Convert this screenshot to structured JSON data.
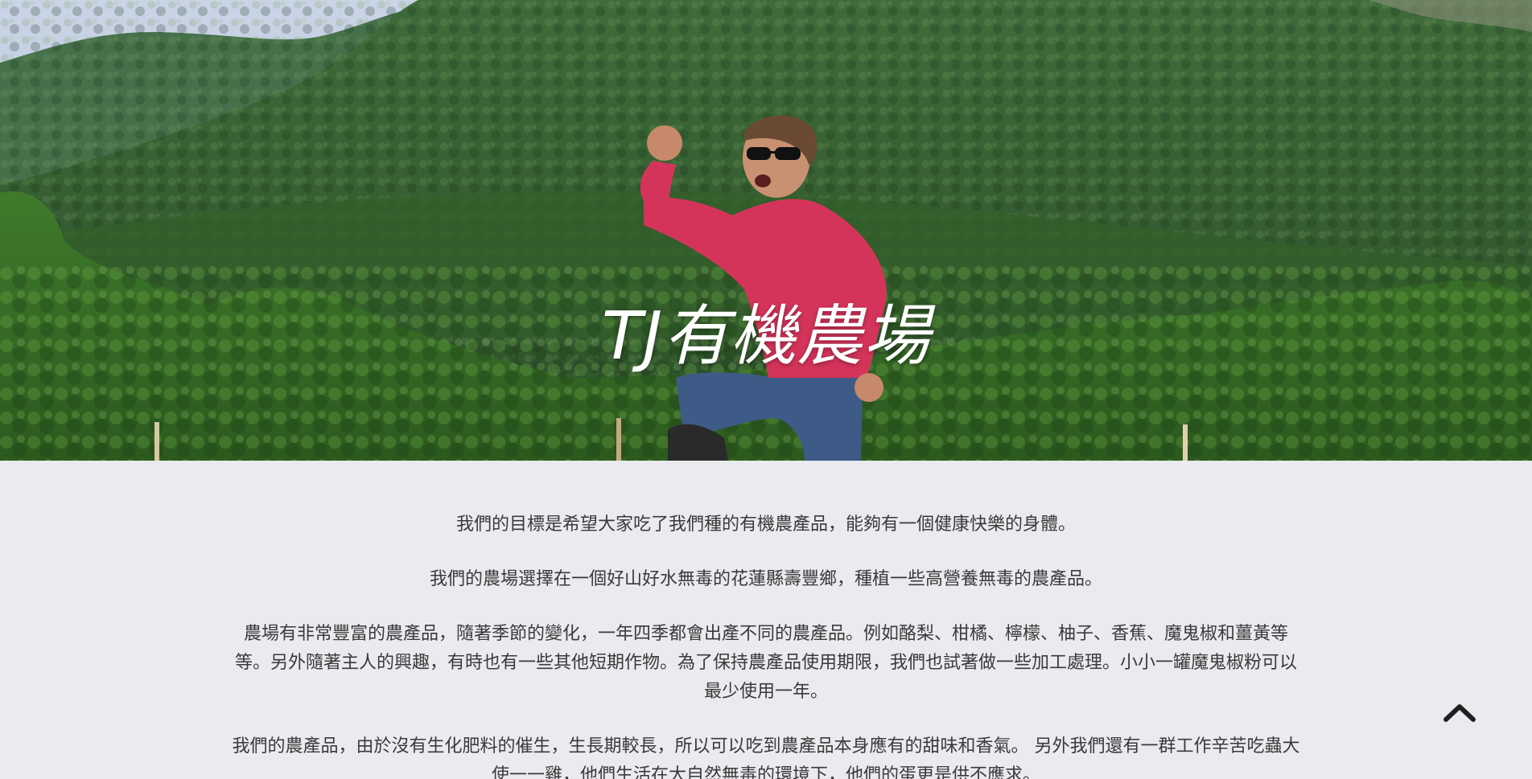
{
  "hero": {
    "title": "TJ有機農場",
    "image_alt": "farmer-jumping-in-green-mountains-photo"
  },
  "about": {
    "paragraphs": [
      "我們的目標是希望大家吃了我們種的有機農產品，能夠有一個健康快樂的身體。",
      "我們的農場選擇在一個好山好水無毒的花蓮縣壽豐鄉，種植一些高營養無毒的農產品。",
      "農場有非常豐富的農產品，隨著季節的變化，一年四季都會出產不同的農產品。例如酪梨、柑橘、檸檬、柚子、香蕉、魔鬼椒和薑黃等等。另外隨著主人的興趣，有時也有一些其他短期作物。為了保持農產品使用期限，我們也試著做一些加工處理。小小一罐魔鬼椒粉可以最少使用一年。",
      "我們的農產品，由於沒有生化肥料的催生，生長期較長，所以可以吃到農產品本身應有的甜味和香氣。 另外我們還有一群工作辛苦吃蟲大使一一雞，他們生活在大自然無毒的環境下，他們的蛋更是供不應求。"
    ]
  },
  "scroll_top": {
    "icon": "chevron-up-icon"
  },
  "colors": {
    "background": "#e9ebee",
    "text": "#3a3a3a",
    "title": "#ffffff"
  }
}
